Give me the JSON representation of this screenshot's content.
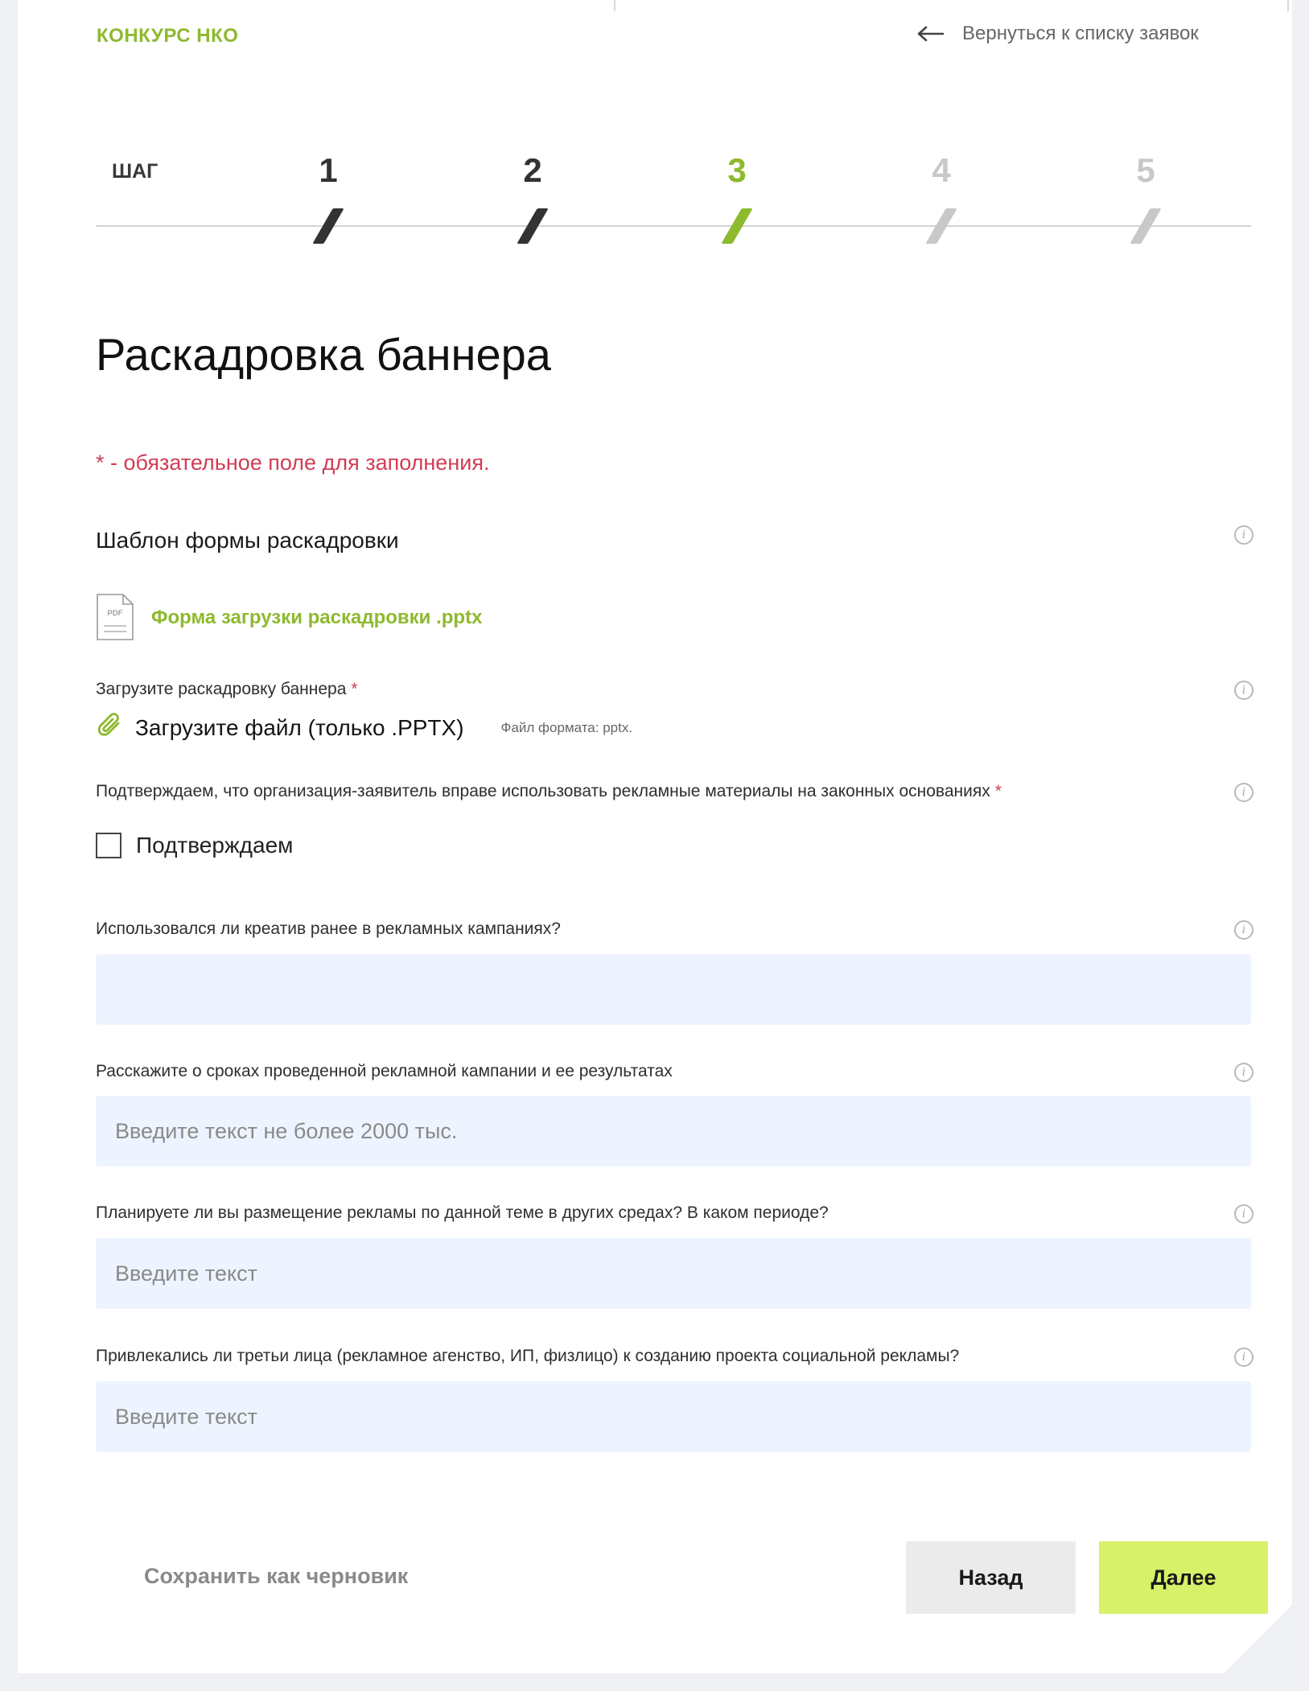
{
  "header": {
    "brand": "КОНКУРС НКО",
    "back_link": "Вернуться к списку заявок"
  },
  "stepper": {
    "label": "ШАГ",
    "steps": [
      {
        "number": "1",
        "state": "done"
      },
      {
        "number": "2",
        "state": "done"
      },
      {
        "number": "3",
        "state": "current"
      },
      {
        "number": "4",
        "state": "upcoming"
      },
      {
        "number": "5",
        "state": "upcoming"
      }
    ],
    "colors": {
      "done": "#333333",
      "current": "#8dba2f",
      "upcoming": "#c8c8c8"
    }
  },
  "page": {
    "title": "Раскадровка баннера",
    "required_note": "* - обязательное поле для заполнения."
  },
  "template": {
    "label": "Шаблон формы раскадровки",
    "file_icon_text": "PDF",
    "file_link": "Форма загрузки раскадровки .pptx"
  },
  "upload": {
    "label": "Загрузите раскадровку баннера",
    "required_mark": "*",
    "button": "Загрузите файл (только .PPTX)",
    "hint": "Файл формата: pptx."
  },
  "confirm": {
    "label": "Подтверждаем, что организация-заявитель вправе использовать рекламные материалы на законных основаниях",
    "required_mark": "*",
    "checkbox_label": "Подтверждаем",
    "checked": false
  },
  "fields": [
    {
      "label": "Использовался ли креатив ранее в рекламных кампаниях?",
      "value": "",
      "placeholder": ""
    },
    {
      "label": "Расскажите о сроках проведенной рекламной кампании и ее результатах",
      "value": "",
      "placeholder": "Введите текст не более 2000 тыс."
    },
    {
      "label": "Планируете ли вы размещение рекламы по данной теме в других средах? В каком периоде?",
      "value": "",
      "placeholder": "Введите текст"
    },
    {
      "label": "Привлекались ли третьи лица (рекламное агенство, ИП, физлицо) к созданию проекта социальной рекламы?",
      "value": "",
      "placeholder": "Введите текст"
    }
  ],
  "actions": {
    "save_draft": "Сохранить как черновик",
    "back": "Назад",
    "next": "Далее"
  },
  "icons": {
    "back": "arrow-left-icon",
    "info": "info-circle-icon",
    "file": "pdf-file-icon",
    "attach": "paperclip-icon"
  },
  "colors": {
    "accent": "#8dba2f",
    "required": "#d23c55",
    "input_bg": "#eef4ff",
    "next_button": "#d7f168"
  }
}
